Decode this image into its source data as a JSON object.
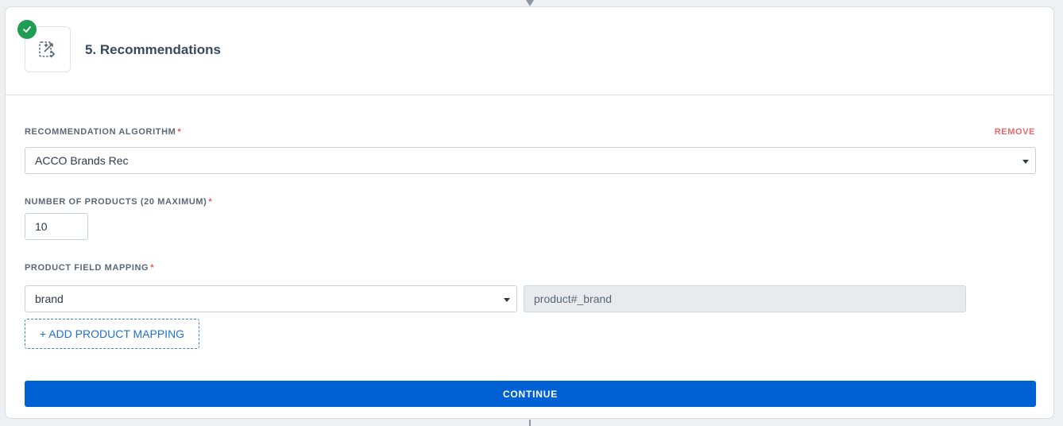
{
  "step": {
    "title": "5. Recommendations",
    "status_icon": "check-icon",
    "step_icon": "recommendations-icon"
  },
  "algorithm": {
    "label": "RECOMMENDATION ALGORITHM",
    "required_mark": "*",
    "remove_label": "REMOVE",
    "value": "ACCO Brands Rec"
  },
  "products": {
    "label": "NUMBER OF PRODUCTS (20 MAXIMUM)",
    "required_mark": "*",
    "value": "10"
  },
  "mapping": {
    "label": "PRODUCT FIELD MAPPING",
    "required_mark": "*",
    "field_value": "brand",
    "mapped_value": "product#_brand",
    "add_label": "+ ADD PRODUCT MAPPING"
  },
  "continue_label": "CONTINUE",
  "colors": {
    "primary": "#0061d5",
    "success": "#1f9d55",
    "danger": "#e46a6a"
  }
}
